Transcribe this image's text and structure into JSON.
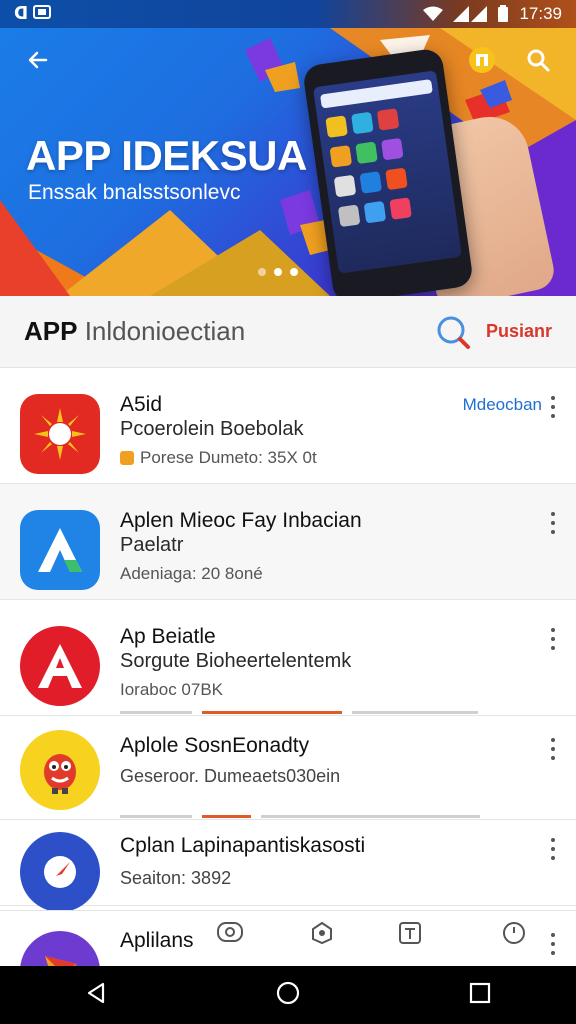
{
  "status_bar": {
    "left_label": "ᗡ",
    "time": "17:39"
  },
  "hero": {
    "title": "APP IDEKSUA",
    "subtitle": "Enssak bnalsstsonlevc",
    "dots": 3,
    "active_dot": 2
  },
  "section": {
    "title_bold": "APP",
    "title_rest": " Inldonioectian",
    "search_label": "Pusianr"
  },
  "apps": [
    {
      "name": "A5id",
      "desc": "Pcoerolein Boebolak",
      "meta": "Porese Dumeto: 35X 0t",
      "link": "Mdeocban",
      "icon": "sun-icon",
      "color": "#e32a22"
    },
    {
      "name": "Aplen Mieoc Fay Inbacian",
      "desc": "Paelatr",
      "meta": "Adeniaga: 20 8oné",
      "link": "",
      "icon": "letter-a-blue-icon",
      "color": "#1f84e6"
    },
    {
      "name": "Ap Beiatle",
      "desc": "Sorgute Bioheertelentemk",
      "meta": "Ioraboc 07BK",
      "link": "",
      "icon": "letter-a-red-icon",
      "color": "#e21d2a"
    },
    {
      "name": "Aplole SosnEonadty",
      "desc": "Geseroor. Dumeaets030ein",
      "meta": "",
      "link": "",
      "icon": "mascot-icon",
      "color": "#f7d21e"
    },
    {
      "name": "Cplan Lapinapantiskasosti",
      "desc": "Seaiton: 3892",
      "meta": "",
      "link": "",
      "icon": "compass-icon",
      "color": "#2d4fc8"
    },
    {
      "name": "Aplilans",
      "desc": "",
      "meta": "",
      "link": "",
      "icon": "arrow-icon",
      "color": "#6d3bd0"
    }
  ],
  "bottom_tabs": [
    {
      "label": "",
      "icon": "settings-tab-icon"
    },
    {
      "label": "",
      "icon": "badge-tab-icon"
    },
    {
      "label": "",
      "icon": "t-tab-icon"
    },
    {
      "label": "",
      "icon": "clock-tab-icon"
    }
  ],
  "colors": {
    "accent_red": "#d9382b",
    "link_blue": "#1f6fd0",
    "hero_blue": "#1a7ee8"
  }
}
